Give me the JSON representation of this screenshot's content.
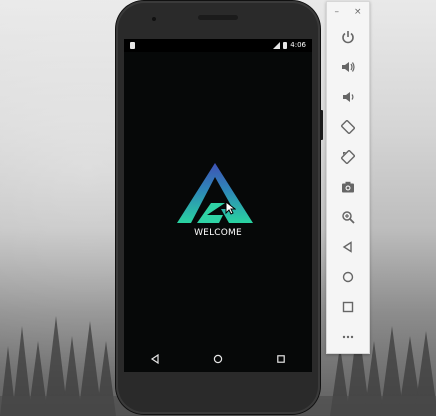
{
  "status_bar": {
    "time": "4:06"
  },
  "screen": {
    "welcome_text": "WELCOME"
  },
  "nav": {
    "back": "back-icon",
    "home": "home-icon",
    "recents": "recents-icon"
  },
  "toolbar": {
    "minimize": "–",
    "close": "×",
    "buttons": [
      "power",
      "volume-up",
      "volume-down",
      "rotate-left",
      "rotate-right",
      "camera",
      "zoom",
      "back",
      "home",
      "overview",
      "more"
    ]
  },
  "colors": {
    "logo_top": "#3f51b5",
    "logo_bottom": "#29d3a0",
    "screen_bg": "#060808"
  }
}
